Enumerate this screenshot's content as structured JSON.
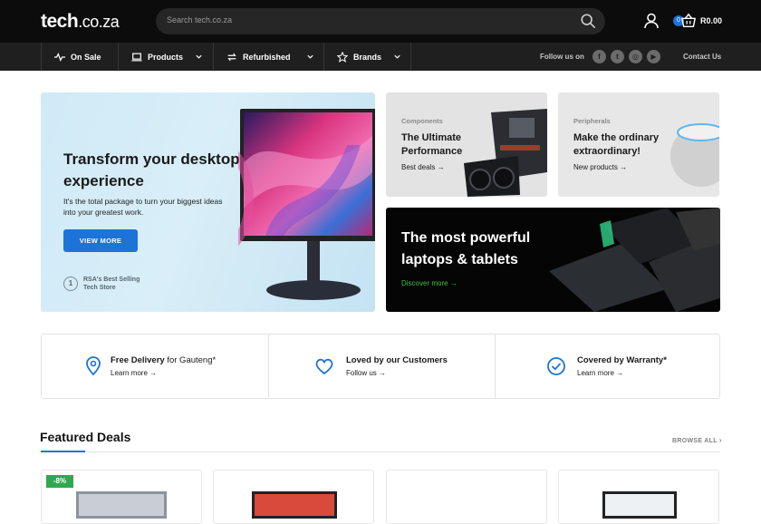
{
  "header": {
    "logo_main": "tech",
    "logo_domain": ".co.za",
    "search_placeholder": "Search tech.co.za",
    "cart_count": "0",
    "cart_total": "R0.00"
  },
  "nav": {
    "items": [
      {
        "label": "On Sale",
        "icon": "pulse-icon"
      },
      {
        "label": "Products",
        "icon": "laptop-icon"
      },
      {
        "label": "Refurbished",
        "icon": "refresh-icon"
      },
      {
        "label": "Brands",
        "icon": "star-icon"
      }
    ],
    "follow_label": "Follow us on",
    "social": [
      "facebook-icon",
      "twitter-icon",
      "instagram-icon",
      "youtube-icon"
    ],
    "contact_label": "Contact Us"
  },
  "hero": {
    "title": "Transform your desktop experience",
    "body": "It's the total package to turn your biggest ideas into your greatest work.",
    "button": "VIEW MORE",
    "award_number": "1",
    "award_text": "RSA's Best Selling Tech Store"
  },
  "promos": {
    "components": {
      "eyebrow": "Components",
      "title": "The Ultimate Performance",
      "link": "Best deals"
    },
    "peripherals": {
      "eyebrow": "Peripherals",
      "title": "Make the ordinary extraordinary!",
      "link": "New products"
    },
    "laptops": {
      "title": "The most powerful laptops & tablets",
      "link": "Discover more"
    }
  },
  "features": [
    {
      "bold": "Free Delivery",
      "rest": " for Gauteng*",
      "link": "Learn more",
      "icon": "location-pin-icon"
    },
    {
      "bold": "Loved by our Customers",
      "rest": "",
      "link": "Follow us",
      "icon": "heart-icon"
    },
    {
      "bold": "Covered by Warranty*",
      "rest": "",
      "link": "Learn more",
      "icon": "check-circle-icon"
    }
  ],
  "featured": {
    "title": "Featured Deals",
    "browse": "BROWSE ALL",
    "first_badge": "-8%"
  },
  "colors": {
    "accent": "#1e73d8",
    "topbar": "#0c0c0c",
    "navbar": "#1f1f1f",
    "discover_green": "#3fbf3f",
    "sale_badge": "#2fa84f"
  }
}
